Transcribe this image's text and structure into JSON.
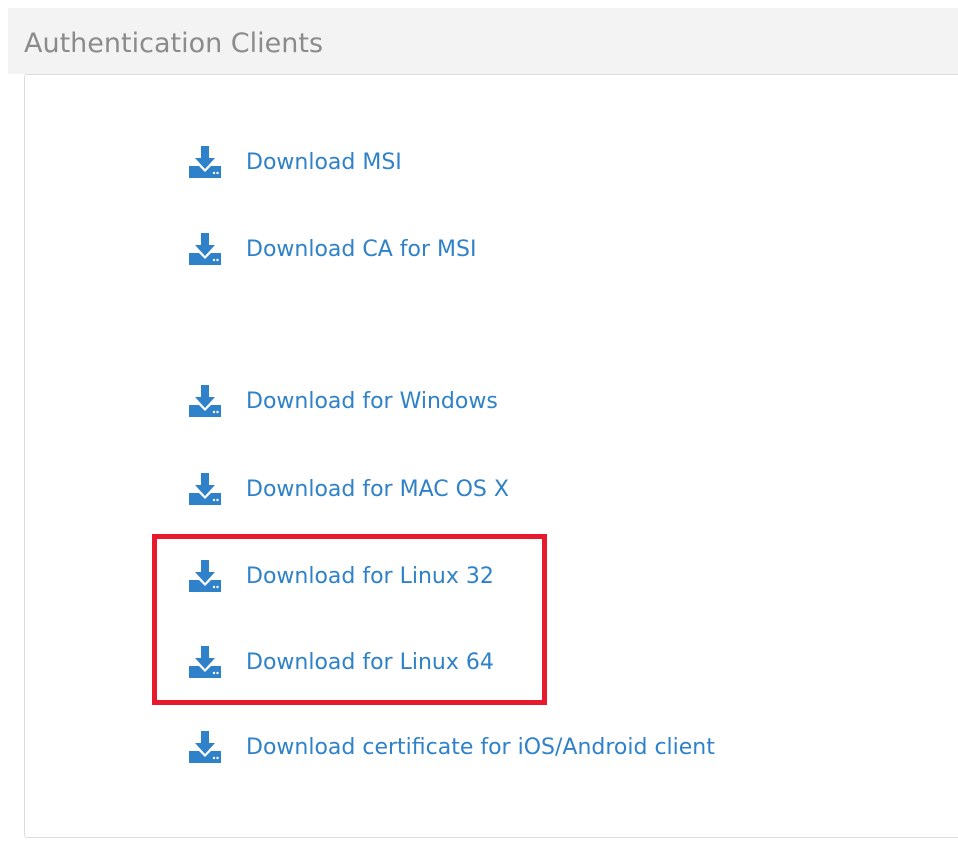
{
  "section": {
    "title": "Authentication Clients"
  },
  "links": [
    {
      "label": "Download MSI",
      "icon": "download-icon"
    },
    {
      "label": "Download CA for MSI",
      "icon": "download-icon"
    },
    {
      "label": "Download for Windows",
      "icon": "download-icon"
    },
    {
      "label": "Download for MAC OS X",
      "icon": "download-icon"
    },
    {
      "label": "Download for Linux 32",
      "icon": "download-icon"
    },
    {
      "label": "Download for Linux 64",
      "icon": "download-icon"
    },
    {
      "label": "Download certificate for iOS/Android client",
      "icon": "download-icon"
    }
  ],
  "colors": {
    "link": "#2f82c9",
    "icon": "#2f82c9",
    "title": "#8b8b8b",
    "header_bg": "#f3f3f3",
    "highlight": "#e8192c"
  }
}
